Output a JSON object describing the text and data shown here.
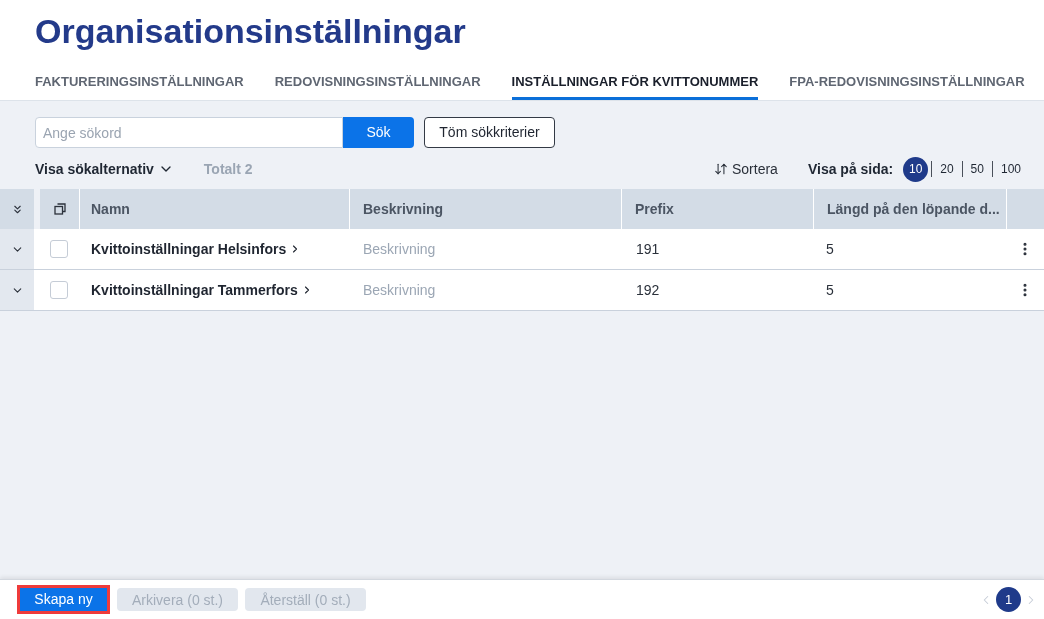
{
  "page": {
    "title": "Organisationsinställningar"
  },
  "tabs": [
    {
      "label": "FAKTURERINGSINSTÄLLNINGAR",
      "selected": false
    },
    {
      "label": "REDOVISNINGSINSTÄLLNINGAR",
      "selected": false
    },
    {
      "label": "INSTÄLLNINGAR FÖR KVITTONUMMER",
      "selected": true
    },
    {
      "label": "FPA-REDOVISNINGSINSTÄLLNINGAR",
      "selected": false
    }
  ],
  "search": {
    "placeholder": "Ange sökord",
    "submit_button": "Sök",
    "clear_button": "Töm sökkriterier"
  },
  "toolbar": {
    "options_toggle": "Visa sökalternativ",
    "total": "Totalt 2",
    "sort_button": "Sortera",
    "page_size_label": "Visa på sida:",
    "page_sizes": [
      {
        "label": "10",
        "selected": true
      },
      {
        "label": "20",
        "selected": false
      },
      {
        "label": "50",
        "selected": false
      },
      {
        "label": "100",
        "selected": false
      }
    ]
  },
  "table": {
    "columns": [
      "Namn",
      "Beskrivning",
      "Prefix",
      "Längd på den löpande d..."
    ],
    "rows": [
      {
        "expanded": false,
        "checked": false,
        "name": "Kvittoinställningar Helsinfors",
        "description": "Beskrivning",
        "prefix": "191",
        "length": "5"
      },
      {
        "expanded": false,
        "checked": false,
        "name": "Kvittoinställningar Tammerfors",
        "description": "Beskrivning",
        "prefix": "192",
        "length": "5"
      }
    ]
  },
  "footer": {
    "buttons": [
      {
        "label": "Skapa ny",
        "kind": "primary",
        "disabled": false,
        "focused": true
      },
      {
        "label": "Arkivera (0 st.)",
        "kind": "secondary",
        "disabled": true,
        "focused": false
      },
      {
        "label": "Återställ (0 st.)",
        "kind": "secondary",
        "disabled": true,
        "focused": false
      }
    ],
    "pagination": [
      {
        "label": "1",
        "selected": true
      }
    ]
  }
}
